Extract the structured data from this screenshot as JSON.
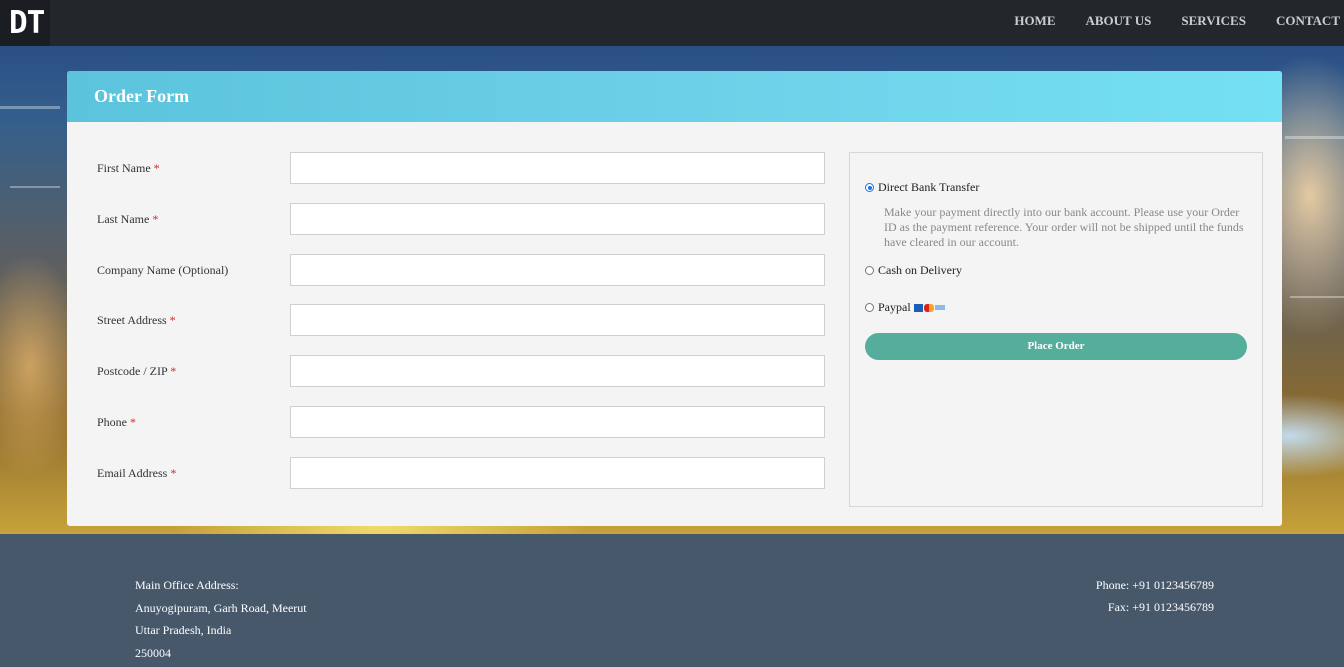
{
  "logo": "DT",
  "nav": [
    "HOME",
    "ABOUT US",
    "SERVICES",
    "CONTACT"
  ],
  "form": {
    "title": "Order Form",
    "fields": [
      {
        "label": "First Name",
        "required": true
      },
      {
        "label": "Last Name",
        "required": true
      },
      {
        "label": "Company Name (Optional)",
        "required": false
      },
      {
        "label": "Street Address",
        "required": true
      },
      {
        "label": "Postcode / ZIP",
        "required": true
      },
      {
        "label": "Phone",
        "required": true
      },
      {
        "label": "Email Address",
        "required": true
      }
    ],
    "required_mark": "*"
  },
  "payment": {
    "options": [
      {
        "label": "Direct Bank Transfer",
        "selected": true
      },
      {
        "label": "Cash on Delivery",
        "selected": false
      },
      {
        "label": "Paypal",
        "selected": false
      }
    ],
    "bank_description": "Make your payment directly into our bank account. Please use your Order ID as the payment reference. Your order will not be shipped until the funds have cleared in our account.",
    "place_order_label": "Place Order",
    "button_color": "#55ad9c"
  },
  "footer": {
    "address_lines": [
      "Main Office Address:",
      "Anuyogipuram, Garh Road, Meerut",
      "Uttar Pradesh, India",
      "250004"
    ],
    "phone": "Phone: +91 0123456789",
    "fax": "Fax: +91 0123456789"
  },
  "colors": {
    "header_gradient_start": "#5bc3dc",
    "header_gradient_end": "#74e0f3",
    "topbar": "#23272c",
    "footer": "#47586b",
    "required": "#e02020"
  }
}
